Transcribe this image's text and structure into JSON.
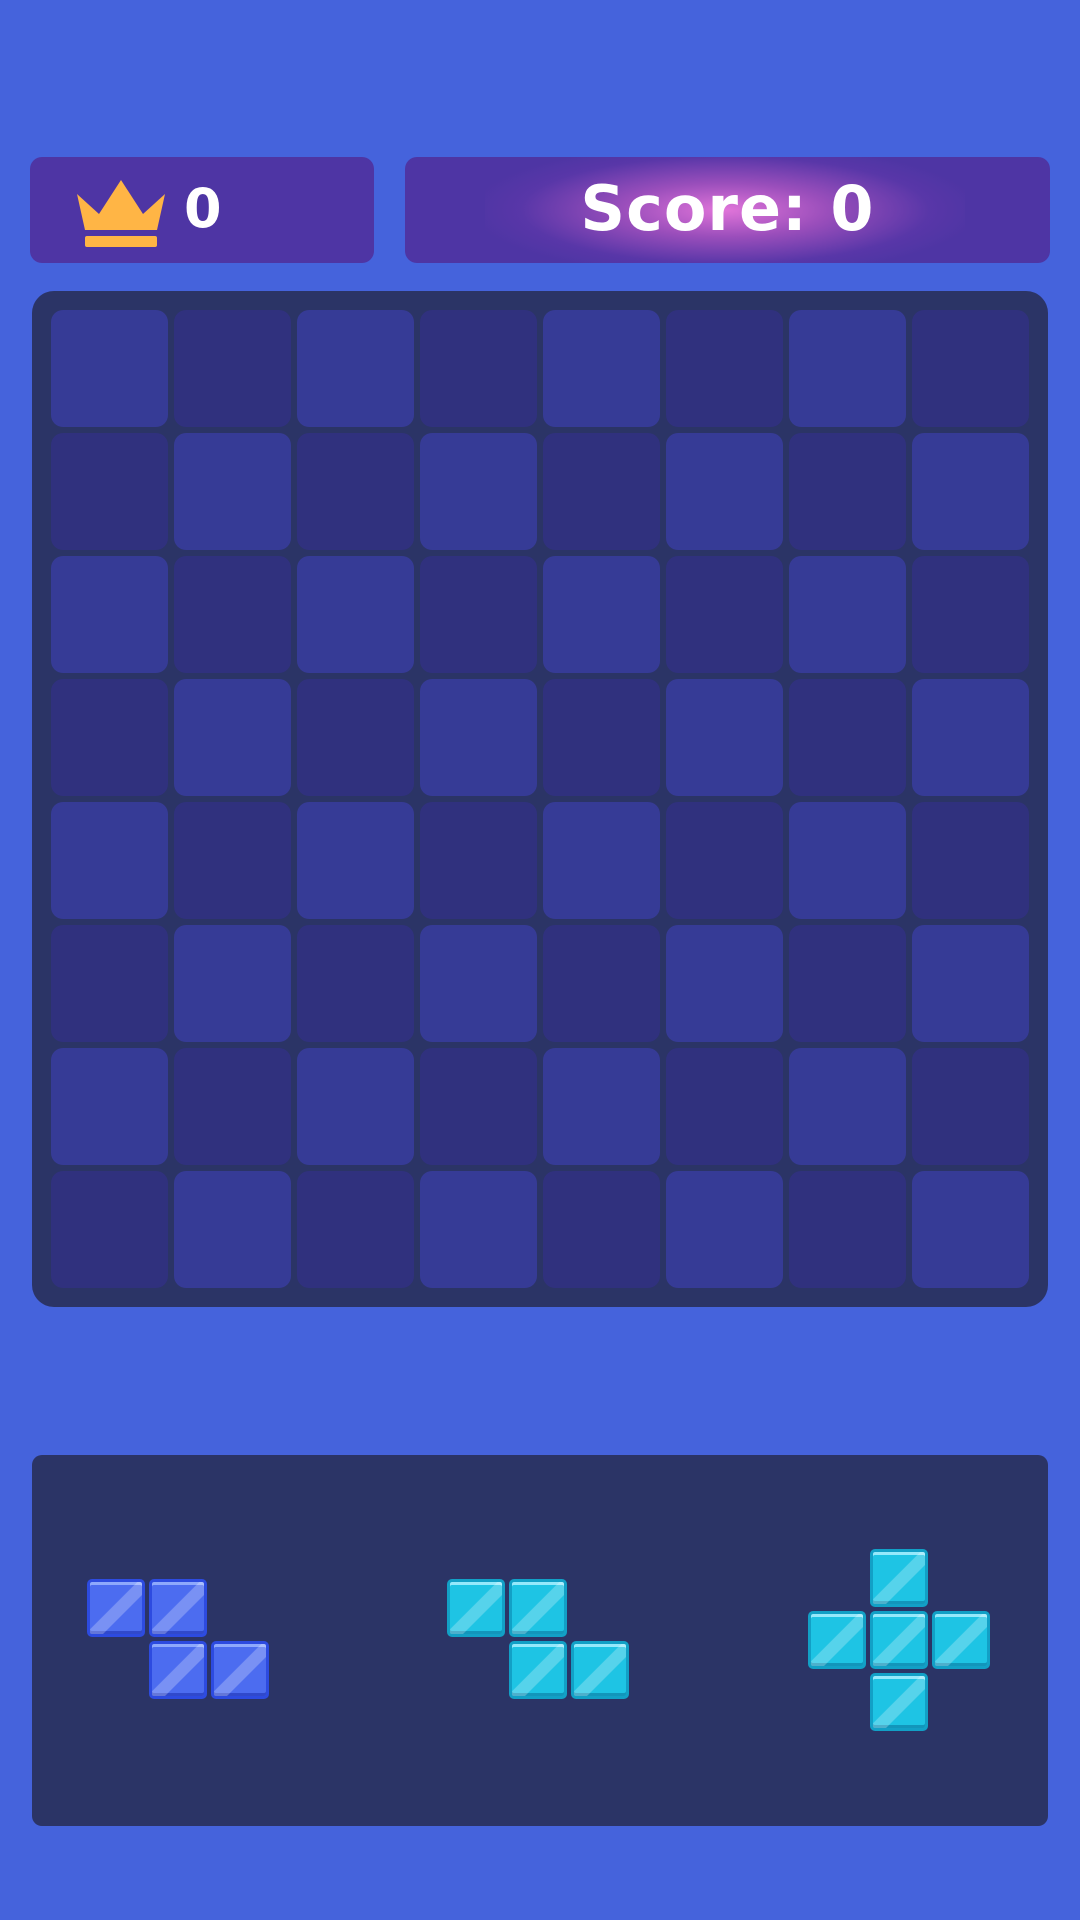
{
  "top_bar": {
    "best_score": "0",
    "crown_icon": "crown-icon",
    "score_label": "Score: 0",
    "crown_color": "#ffb545",
    "panel_color": "#4e35a4"
  },
  "board": {
    "rows": 8,
    "cols": 8,
    "filled_cells": 0,
    "light_color": "#363b96",
    "dark_color": "#30317e",
    "frame_color": "#2b3466"
  },
  "tray": {
    "pieces": [
      {
        "name": "piece-z-blue",
        "color": "blue",
        "cells": [
          [
            0,
            0
          ],
          [
            0,
            1
          ],
          [
            1,
            1
          ],
          [
            1,
            2
          ]
        ]
      },
      {
        "name": "piece-z-cyan",
        "color": "cyan",
        "cells": [
          [
            0,
            0
          ],
          [
            0,
            1
          ],
          [
            1,
            1
          ],
          [
            1,
            2
          ]
        ]
      },
      {
        "name": "piece-plus-cyan",
        "color": "cyan",
        "cells": [
          [
            0,
            1
          ],
          [
            1,
            0
          ],
          [
            1,
            1
          ],
          [
            1,
            2
          ],
          [
            2,
            1
          ]
        ]
      }
    ],
    "block_colors": {
      "blue": "#4c6cf0",
      "cyan": "#1ec4e4"
    }
  },
  "background_color": "#4563dc"
}
